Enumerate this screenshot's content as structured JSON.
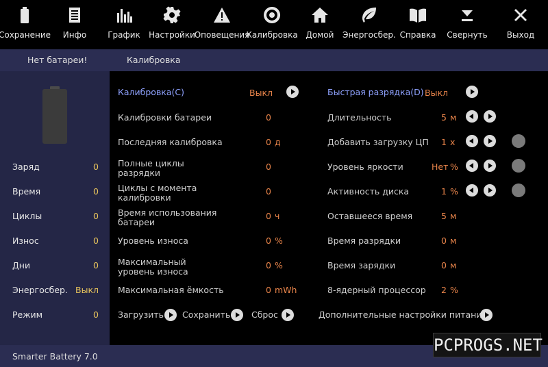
{
  "toolbar": {
    "items": [
      {
        "label": "Сохранение",
        "icon": "battery-icon"
      },
      {
        "label": "Инфо",
        "icon": "document-icon"
      },
      {
        "label": "График",
        "icon": "bar-chart-icon"
      },
      {
        "label": "Настройки",
        "icon": "gear-icon"
      },
      {
        "label": "Оповещения",
        "icon": "warning-icon"
      },
      {
        "label": "Калибровка",
        "icon": "target-icon"
      },
      {
        "label": "Домой",
        "icon": "home-icon"
      },
      {
        "label": "Энергосбер.",
        "icon": "leaf-icon"
      },
      {
        "label": "Справка",
        "icon": "book-icon"
      },
      {
        "label": "Свернуть",
        "icon": "minimize-icon"
      },
      {
        "label": "Выход",
        "icon": "close-icon"
      }
    ]
  },
  "tabs": {
    "no_battery": "Нет батареи!",
    "calibration": "Калибровка"
  },
  "left_panel": {
    "rows": [
      {
        "label": "Заряд",
        "value": "0"
      },
      {
        "label": "Время",
        "value": "0"
      },
      {
        "label": "Циклы",
        "value": "0"
      },
      {
        "label": "Износ",
        "value": "0"
      },
      {
        "label": "Дни",
        "value": "0"
      },
      {
        "label": "Энергосбер.",
        "value": "Выкл"
      },
      {
        "label": "Режим",
        "value": "0"
      }
    ]
  },
  "main": {
    "calibration": {
      "link": "Калибровка(C)",
      "status": "Выкл",
      "rows": [
        {
          "label": "Калибровки батареи",
          "value": "0"
        },
        {
          "label": "Последняя калибровка",
          "value": "0",
          "unit": "д"
        },
        {
          "label": "Полные циклы разрядки",
          "value": "0"
        },
        {
          "label": "Циклы с момента калибровки",
          "value": "0"
        },
        {
          "label": "Время использования батареи",
          "value": "0",
          "unit": "ч"
        },
        {
          "label": "Уровень износа",
          "value": "0",
          "unit": "%"
        },
        {
          "label": "Максимальный уровень износа",
          "value": "0",
          "unit": "%"
        },
        {
          "label": "Максимальная ёмкость",
          "value": "0",
          "unit": "mWh"
        }
      ]
    },
    "quick_discharge": {
      "link": "Быстрая разрядка(D)",
      "status": "Выкл",
      "rows": [
        {
          "label": "Длительность",
          "value": "5",
          "unit": "м"
        },
        {
          "label": "Добавить загрузку ЦП",
          "value": "1",
          "unit": "x"
        },
        {
          "label": "Уровень яркости",
          "value": "Нет",
          "unit": "%"
        },
        {
          "label": "Активность диска",
          "value": "1",
          "unit": "%"
        },
        {
          "label": "Оставшееся время",
          "value": "5",
          "unit": "м"
        },
        {
          "label": "Время разрядки",
          "value": "0",
          "unit": "м"
        },
        {
          "label": "Время зарядки",
          "value": "0",
          "unit": "м"
        },
        {
          "label": "8-ядерный процессор",
          "value": "2",
          "unit": "%"
        }
      ]
    },
    "actions": {
      "load": "Загрузить",
      "save": "Сохранить",
      "reset": "Сброс",
      "more_power": "Дополнительные настройки питания"
    }
  },
  "status_bar": {
    "version": "Smarter Battery 7.0"
  },
  "watermark": "PCPROGS.NET"
}
